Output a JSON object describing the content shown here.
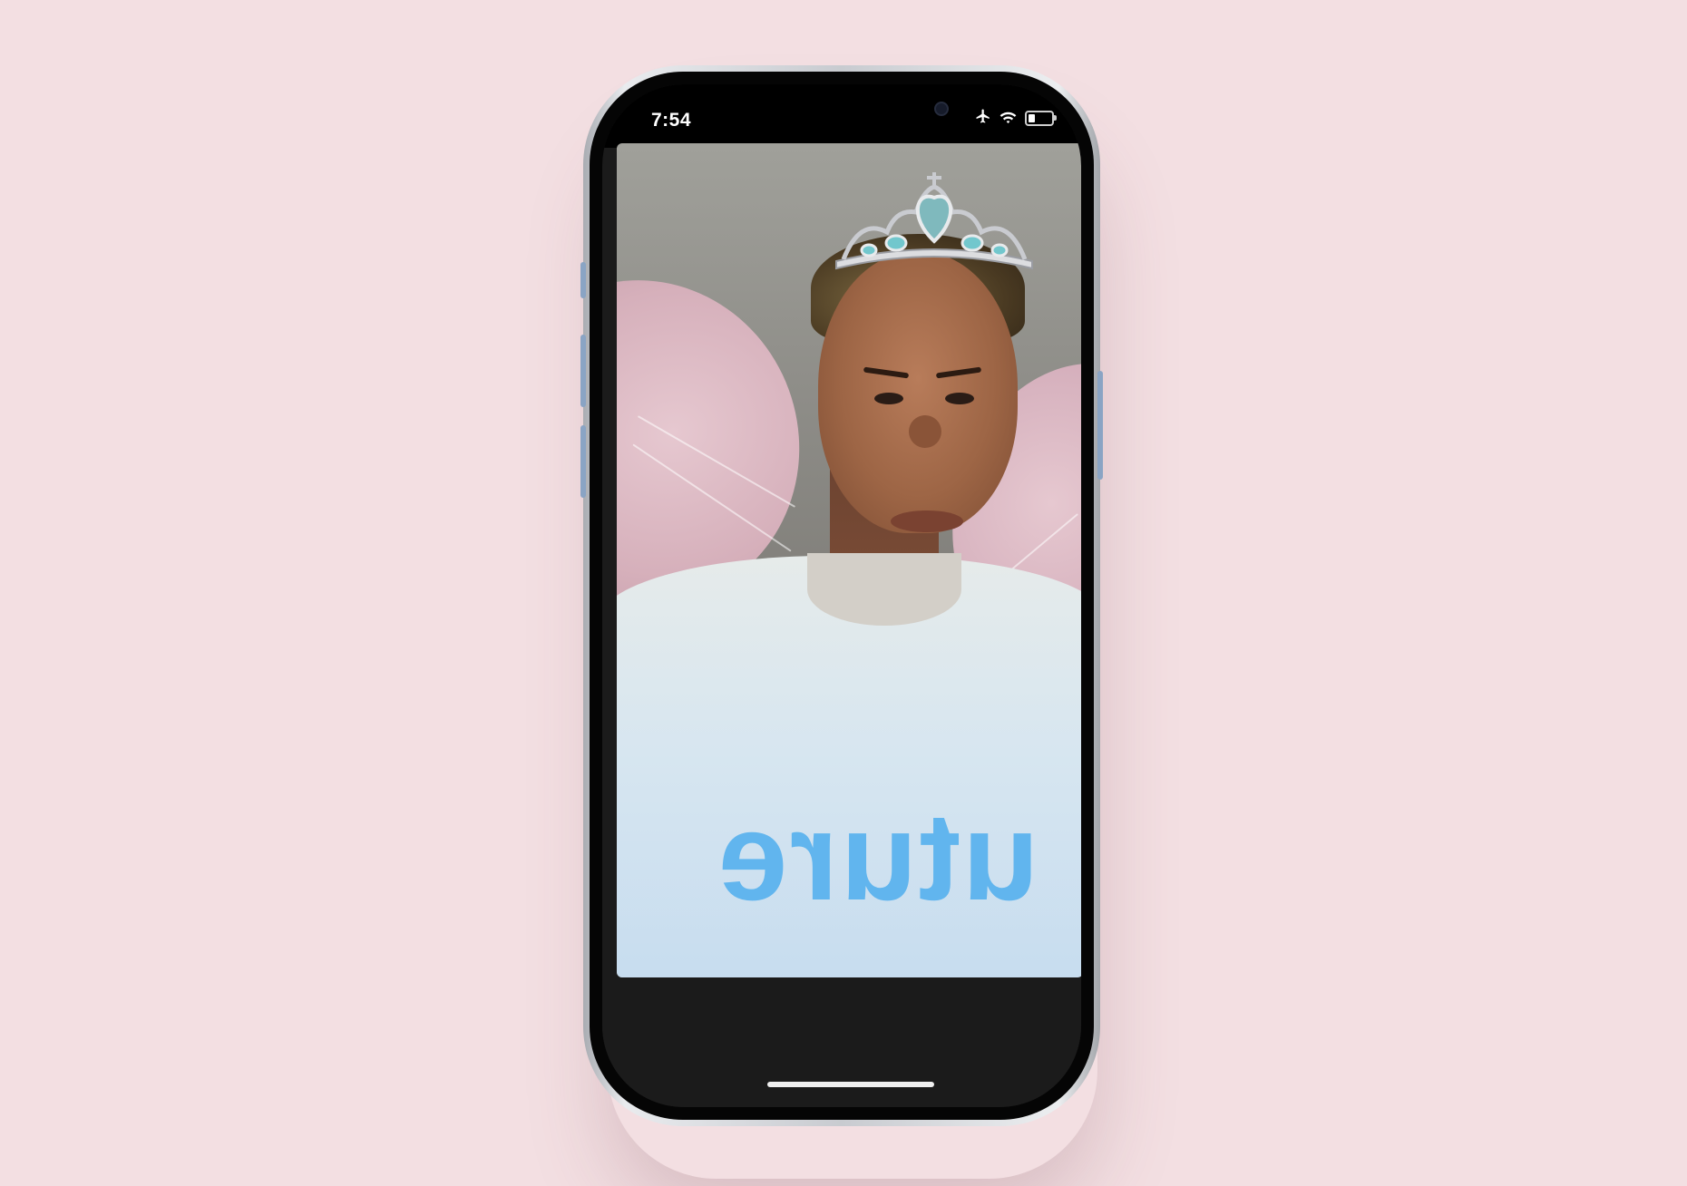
{
  "status_bar": {
    "time": "7:54",
    "icons": [
      "airplane-icon",
      "wifi-icon",
      "battery-icon"
    ]
  },
  "camera": {
    "shirt_text": "uture",
    "filter": "tiara-effect"
  },
  "colors": {
    "background": "#f3dfe2",
    "shirt_print": "#58b2ee"
  }
}
